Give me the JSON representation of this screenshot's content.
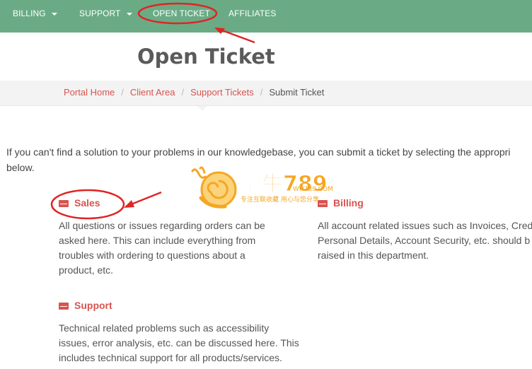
{
  "nav": {
    "items": [
      {
        "label": "BILLING",
        "dropdown": true
      },
      {
        "label": "SUPPORT",
        "dropdown": true
      },
      {
        "label": "OPEN TICKET",
        "dropdown": false
      },
      {
        "label": "AFFILIATES",
        "dropdown": false
      }
    ]
  },
  "page": {
    "title": "Open Ticket"
  },
  "breadcrumb": {
    "items": [
      "Portal Home",
      "Client Area",
      "Support Tickets"
    ],
    "current": "Submit Ticket"
  },
  "intro": {
    "line1": "If you can't find a solution to your problems in our knowledgebase, you can submit a ticket by selecting the appropri",
    "line2": "below."
  },
  "departments": [
    {
      "name": "Sales",
      "lines": [
        "All questions or issues regarding orders can be",
        "asked here. This can include everything from",
        "troubles with ordering to questions about a",
        "product, etc."
      ]
    },
    {
      "name": "Billing",
      "lines": [
        "All account related issues such as Invoices, Cred",
        "Personal Details, Account Security, etc. should b",
        "raised in this department."
      ]
    },
    {
      "name": "Support",
      "lines": [
        "Technical related problems such as accessibility",
        "issues, error analysis, etc. can be discussed here. This",
        "includes technical support for all products/services."
      ]
    }
  ],
  "watermark": {
    "text": "蜗牛789",
    "domain": "WN789.COM",
    "slogan": "专注互联收藏   用心与您分享"
  },
  "colors": {
    "nav_bg": "#6aab85",
    "accent_red": "#d9534f",
    "annotation_red": "#e02424",
    "watermark_orange": "#f5a623"
  }
}
